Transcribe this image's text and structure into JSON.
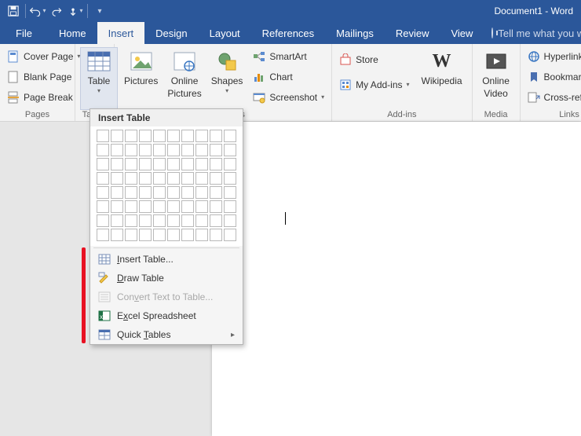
{
  "titlebar": {
    "doc_title": "Document1 - Word",
    "qat": [
      "save",
      "undo",
      "redo",
      "touch-mode"
    ]
  },
  "tabs": {
    "file": "File",
    "items": [
      "Home",
      "Insert",
      "Design",
      "Layout",
      "References",
      "Mailings",
      "Review",
      "View"
    ],
    "active_index": 1,
    "tell_me": "Tell me what you wan"
  },
  "ribbon": {
    "pages": {
      "label": "Pages",
      "cover_page": "Cover Page",
      "blank_page": "Blank Page",
      "page_break": "Page Break"
    },
    "tables": {
      "label": "Tables",
      "table": "Table"
    },
    "illustrations": {
      "label": "Illustrations",
      "pictures": "Pictures",
      "online_pictures_l1": "Online",
      "online_pictures_l2": "Pictures",
      "shapes": "Shapes",
      "smartart": "SmartArt",
      "chart": "Chart",
      "screenshot": "Screenshot"
    },
    "addins": {
      "label": "Add-ins",
      "store": "Store",
      "my_addins": "My Add-ins",
      "wikipedia": "Wikipedia"
    },
    "media": {
      "label": "Media",
      "online_video_l1": "Online",
      "online_video_l2": "Video"
    },
    "links": {
      "label": "Links",
      "hyperlink": "Hyperlink",
      "bookmark": "Bookmark",
      "cross_reference": "Cross-reference"
    }
  },
  "dropdown": {
    "title": "Insert Table",
    "grid_cols": 10,
    "grid_rows": 8,
    "insert_table": "Insert Table...",
    "draw_table": "Draw Table",
    "convert_text": "Convert Text to Table...",
    "excel_spreadsheet": "Excel Spreadsheet",
    "quick_tables": "Quick Tables"
  }
}
